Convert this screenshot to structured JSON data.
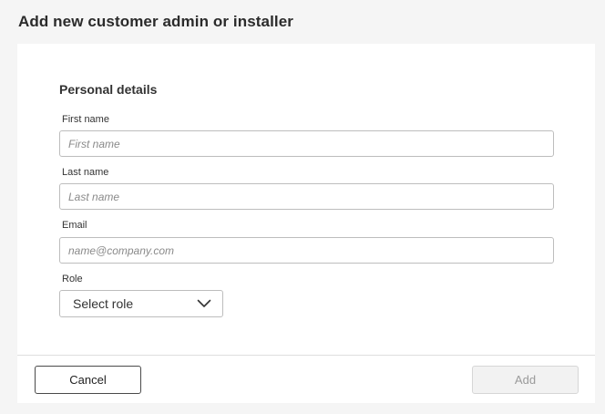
{
  "page": {
    "title": "Add new customer admin or installer"
  },
  "form": {
    "section_title": "Personal details",
    "first_name": {
      "label": "First name",
      "placeholder": "First name",
      "value": ""
    },
    "last_name": {
      "label": "Last name",
      "placeholder": "Last name",
      "value": ""
    },
    "email": {
      "label": "Email",
      "placeholder": "name@company.com",
      "value": ""
    },
    "role": {
      "label": "Role",
      "selected": "Select role",
      "icon": "chevron-down-icon"
    }
  },
  "footer": {
    "cancel_label": "Cancel",
    "add_label": "Add",
    "add_disabled": true
  }
}
